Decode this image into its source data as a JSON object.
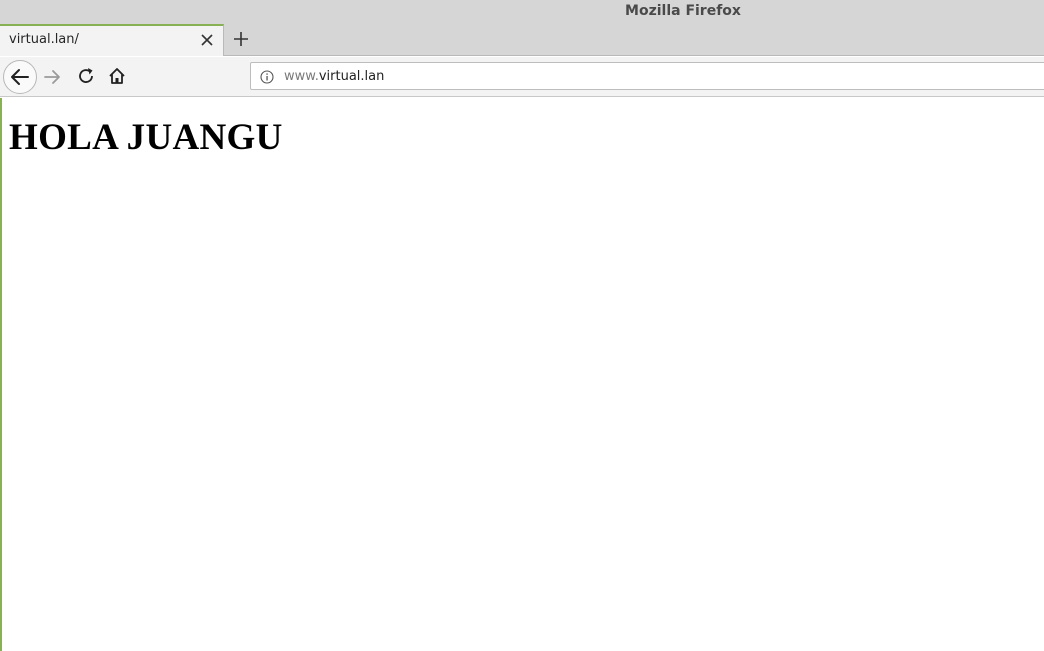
{
  "window": {
    "title": "Mozilla Firefox"
  },
  "tabs": [
    {
      "label": "virtual.lan/",
      "active": true
    }
  ],
  "toolbar": {
    "url_prefix": "www.",
    "url_domain": "virtual.lan"
  },
  "page": {
    "heading": "HOLA JUANGU"
  },
  "colors": {
    "accent": "#87b153",
    "chrome": "#d6d6d6",
    "toolbar": "#f3f3f3"
  }
}
